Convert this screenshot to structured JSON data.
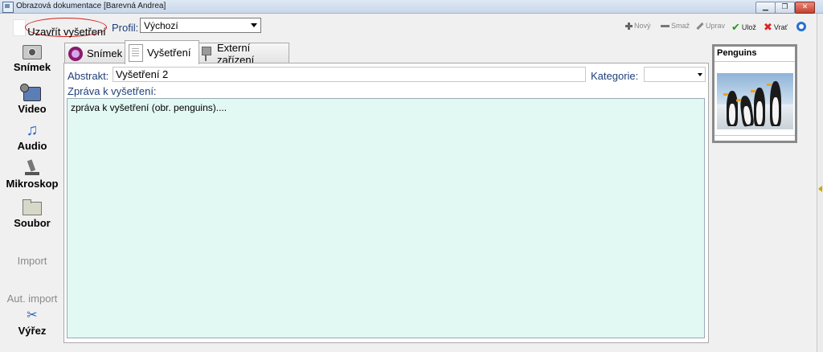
{
  "window": {
    "title": "Obrazová dokumentace [Barevná Andrea]",
    "minimize": "▁",
    "restore": "❐",
    "close": "✕"
  },
  "toolbar": {
    "close_exam_label": "Uzavřít vyšetření",
    "profile_label": "Profil:",
    "profile_value": "Výchozí",
    "new_label": "Nový",
    "delete_label": "Smaž",
    "edit_label": "Uprav",
    "save_label": "Ulož",
    "revert_label": "Vrať"
  },
  "sidebar": {
    "items": [
      {
        "label": "Snímek",
        "icon": "camera-icon",
        "enabled": true
      },
      {
        "label": "Video",
        "icon": "video-camera-icon",
        "enabled": true
      },
      {
        "label": "Audio",
        "icon": "music-note-icon",
        "enabled": true
      },
      {
        "label": "Mikroskop",
        "icon": "microscope-icon",
        "enabled": true
      },
      {
        "label": "Soubor",
        "icon": "folder-icon",
        "enabled": true
      },
      {
        "label": "Import",
        "enabled": false
      },
      {
        "label": "Aut. import",
        "enabled": false
      },
      {
        "label": "Výřez",
        "icon": "scissors-icon",
        "enabled": true
      }
    ]
  },
  "tabs": [
    {
      "label": "Snímek",
      "icon": "eye-icon",
      "active": false
    },
    {
      "label": "Vyšetření",
      "icon": "document-icon",
      "active": true
    },
    {
      "label": "Externí zařízení",
      "icon": "plug-icon",
      "active": false
    }
  ],
  "form": {
    "abstract_label": "Abstrakt:",
    "abstract_value": "Vyšetření 2",
    "category_label": "Kategorie:",
    "category_value": "",
    "report_label": "Zpráva k vyšetření:",
    "report_value": "zpráva k vyšetření (obr. penguins)...."
  },
  "thumbnail": {
    "caption": "Penguins"
  },
  "colors": {
    "accent_label": "#1e3f7a",
    "report_background": "#e2f8f3",
    "highlight_oval": "#d71d1d",
    "save_green": "#1f9c1f",
    "revert_red": "#dd2222"
  }
}
